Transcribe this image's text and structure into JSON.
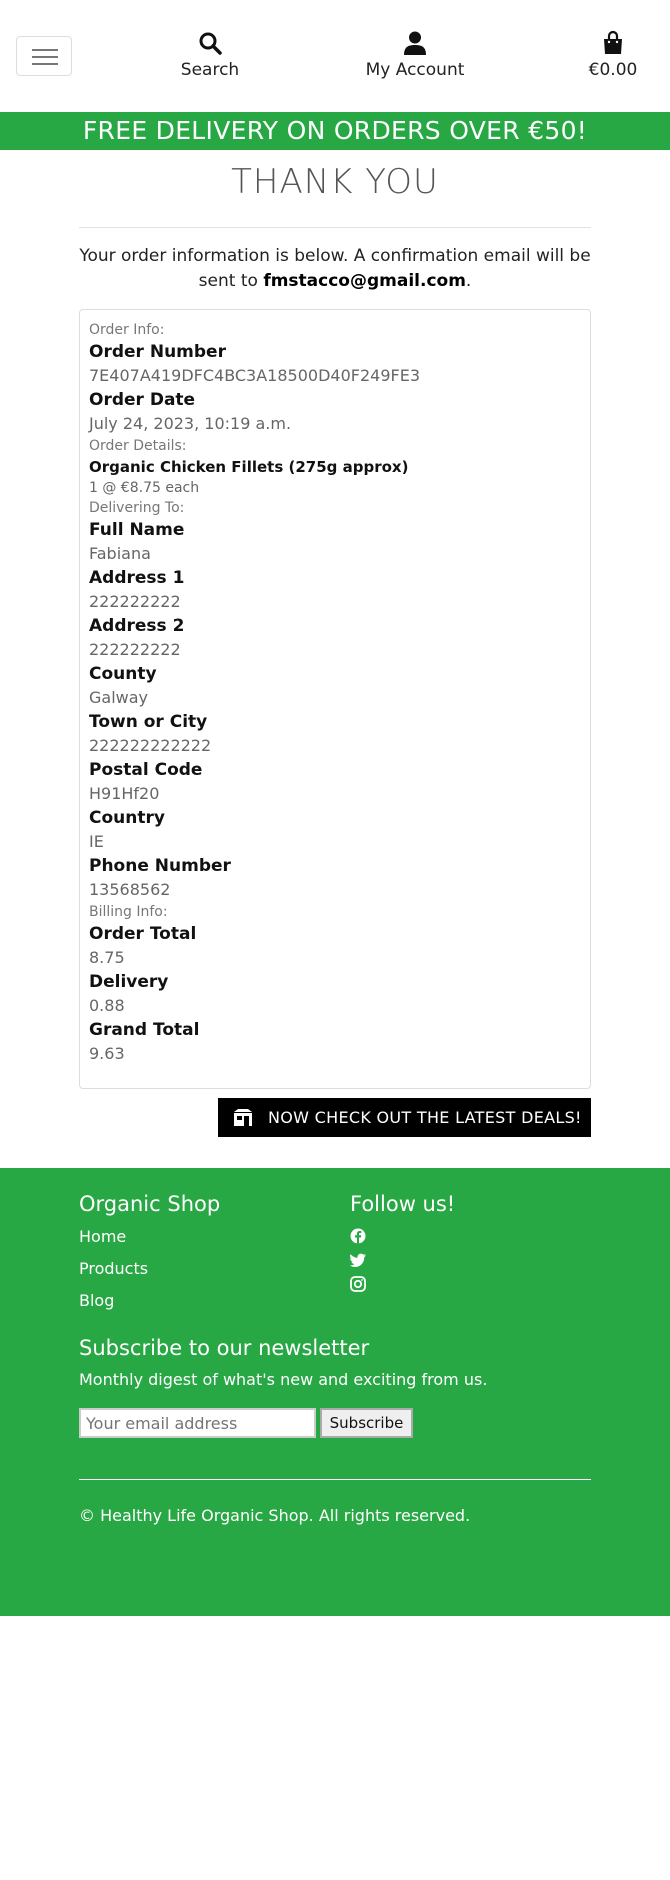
{
  "header": {
    "search_label": "Search",
    "account_label": "My Account",
    "cart_total": "€0.00",
    "icons": {
      "menu": "hamburger-icon",
      "search": "search-icon",
      "account": "user-icon",
      "cart": "shopping-bag-icon"
    }
  },
  "banner": {
    "text": "FREE DELIVERY ON ORDERS OVER €50!"
  },
  "page": {
    "title": "THANK YOU",
    "intro_prefix": "Your order information is below. A confirmation email will be sent to ",
    "email": "fmstacco@gmail.com",
    "intro_suffix": "."
  },
  "order": {
    "order_info_heading": "Order Info:",
    "order_number_label": "Order Number",
    "order_number": "7E407A419DFC4BC3A18500D40F249FE3",
    "order_date_label": "Order Date",
    "order_date": "July 24, 2023, 10:19 a.m.",
    "order_details_heading": "Order Details:",
    "item_name": "Organic Chicken Fillets (275g approx)",
    "item_qty": "1 @ €8.75 each",
    "delivering_heading": "Delivering To:",
    "full_name_label": "Full Name",
    "full_name": "Fabiana",
    "address1_label": "Address 1",
    "address1": "222222222",
    "address2_label": "Address 2",
    "address2": "222222222",
    "county_label": "County",
    "county": "Galway",
    "town_label": "Town or City",
    "town": "222222222222",
    "postal_label": "Postal Code",
    "postal": "H91Hf20",
    "country_label": "Country",
    "country": "IE",
    "phone_label": "Phone Number",
    "phone": "13568562",
    "billing_heading": "Billing Info:",
    "order_total_label": "Order Total",
    "order_total": "8.75",
    "delivery_label": "Delivery",
    "delivery": "0.88",
    "grand_total_label": "Grand Total",
    "grand_total": "9.63"
  },
  "deals_button": {
    "label": "NOW CHECK OUT THE LATEST DEALS!",
    "icon": "shop-icon"
  },
  "footer": {
    "brand": "Organic Shop",
    "links": [
      "Home",
      "Products",
      "Blog"
    ],
    "follow_title": "Follow us!",
    "social_icons": [
      "facebook-icon",
      "twitter-icon",
      "instagram-icon"
    ],
    "newsletter_title": "Subscribe to our newsletter",
    "newsletter_desc": "Monthly digest of what's new and exciting from us.",
    "email_placeholder": "Your email address",
    "subscribe_label": "Subscribe",
    "copyright": "© Healthy Life Organic Shop. All rights reserved."
  },
  "colors": {
    "brand_green": "#28a745",
    "black": "#000000"
  }
}
